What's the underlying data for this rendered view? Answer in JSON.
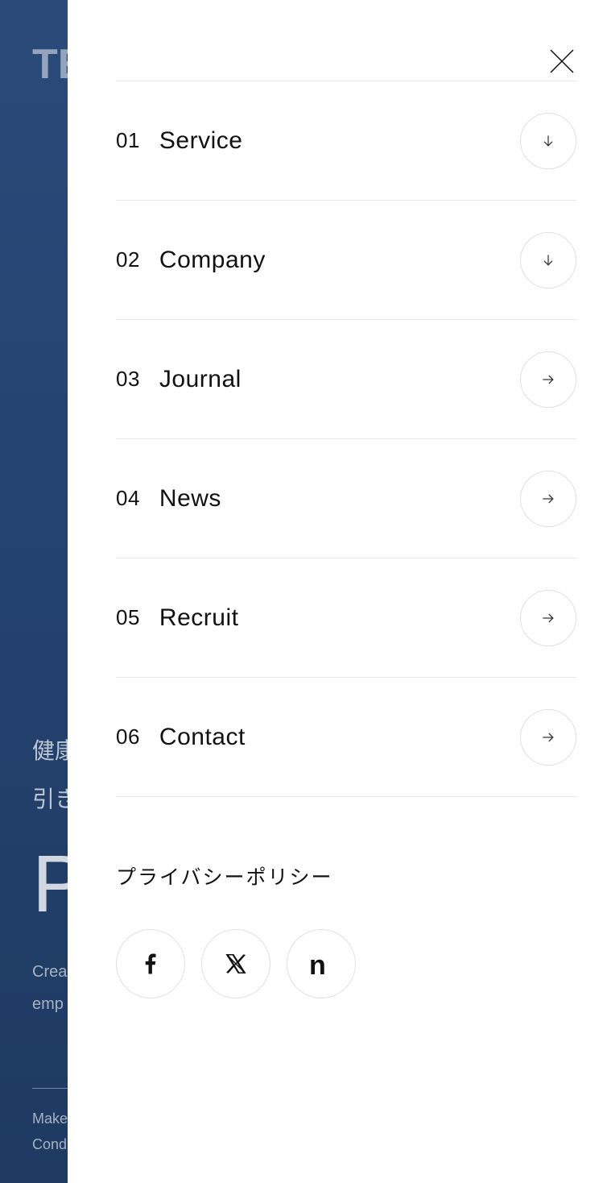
{
  "background": {
    "top_text": "TE",
    "jp_line1": "健康",
    "jp_line2": "引き",
    "big_letter": "P",
    "crea": "Crea",
    "emp": "emp",
    "make": "Make",
    "cond": "Cond"
  },
  "menu": {
    "items": [
      {
        "number": "01",
        "label": "Service",
        "icon": "down"
      },
      {
        "number": "02",
        "label": "Company",
        "icon": "down"
      },
      {
        "number": "03",
        "label": "Journal",
        "icon": "right"
      },
      {
        "number": "04",
        "label": "News",
        "icon": "right"
      },
      {
        "number": "05",
        "label": "Recruit",
        "icon": "right"
      },
      {
        "number": "06",
        "label": "Contact",
        "icon": "right"
      }
    ]
  },
  "privacy_label": "プライバシーポリシー",
  "social": {
    "facebook": "facebook",
    "x": "x-twitter",
    "note": "note"
  }
}
